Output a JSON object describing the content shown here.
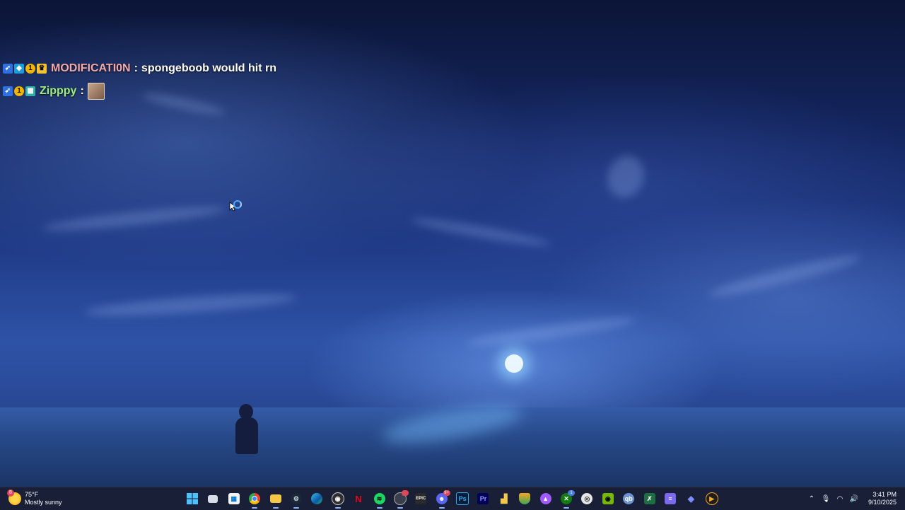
{
  "chat": [
    {
      "badges": [
        "prime-badge",
        "cube-badge",
        "sub-badge",
        "crown-badge"
      ],
      "badge_text": [
        "",
        "",
        "1",
        ""
      ],
      "username": "MODIFICATI0N",
      "username_color": "#f4a9a8",
      "separator": ":",
      "message": "spongeboob would hit rn"
    },
    {
      "badges": [
        "prime-badge",
        "sub-badge",
        "grid-badge"
      ],
      "badge_text": [
        "",
        "1",
        ""
      ],
      "username": "Zipppy",
      "username_color": "#9ef07a",
      "separator": ":",
      "message_emote": "emote-image"
    }
  ],
  "taskbar": {
    "weather": {
      "temperature": "75°F",
      "condition": "Mostly sunny",
      "badge": "8"
    },
    "apps": [
      {
        "name": "start-button",
        "label": ""
      },
      {
        "name": "task-view-button",
        "label": ""
      },
      {
        "name": "microsoft-store-app",
        "label": ""
      },
      {
        "name": "chrome-app",
        "label": ""
      },
      {
        "name": "file-explorer-app",
        "label": ""
      },
      {
        "name": "steam-app",
        "label": ""
      },
      {
        "name": "edge-app",
        "label": ""
      },
      {
        "name": "obs-app",
        "label": ""
      },
      {
        "name": "netflix-app",
        "label": "N"
      },
      {
        "name": "spotify-app",
        "label": ""
      },
      {
        "name": "chrome-alt-app",
        "label": ""
      },
      {
        "name": "epic-games-app",
        "label": "EPIC"
      },
      {
        "name": "discord-app",
        "label": "",
        "badge": "9+"
      },
      {
        "name": "photoshop-app",
        "label": "Ps"
      },
      {
        "name": "premiere-app",
        "label": "Pr"
      },
      {
        "name": "monitor-app",
        "label": ""
      },
      {
        "name": "shield-app",
        "label": ""
      },
      {
        "name": "arc-app",
        "label": ""
      },
      {
        "name": "xbox-app",
        "label": "",
        "badge": "1"
      },
      {
        "name": "settings-app",
        "label": ""
      },
      {
        "name": "nvidia-app",
        "label": ""
      },
      {
        "name": "qbittorrent-app",
        "label": "qb"
      },
      {
        "name": "excel-app",
        "label": ""
      },
      {
        "name": "notes-app",
        "label": ""
      },
      {
        "name": "streamlabs-app",
        "label": ""
      },
      {
        "name": "media-player-app",
        "label": ""
      }
    ],
    "clock": {
      "time": "3:41 PM",
      "date": "9/10/2025"
    }
  }
}
